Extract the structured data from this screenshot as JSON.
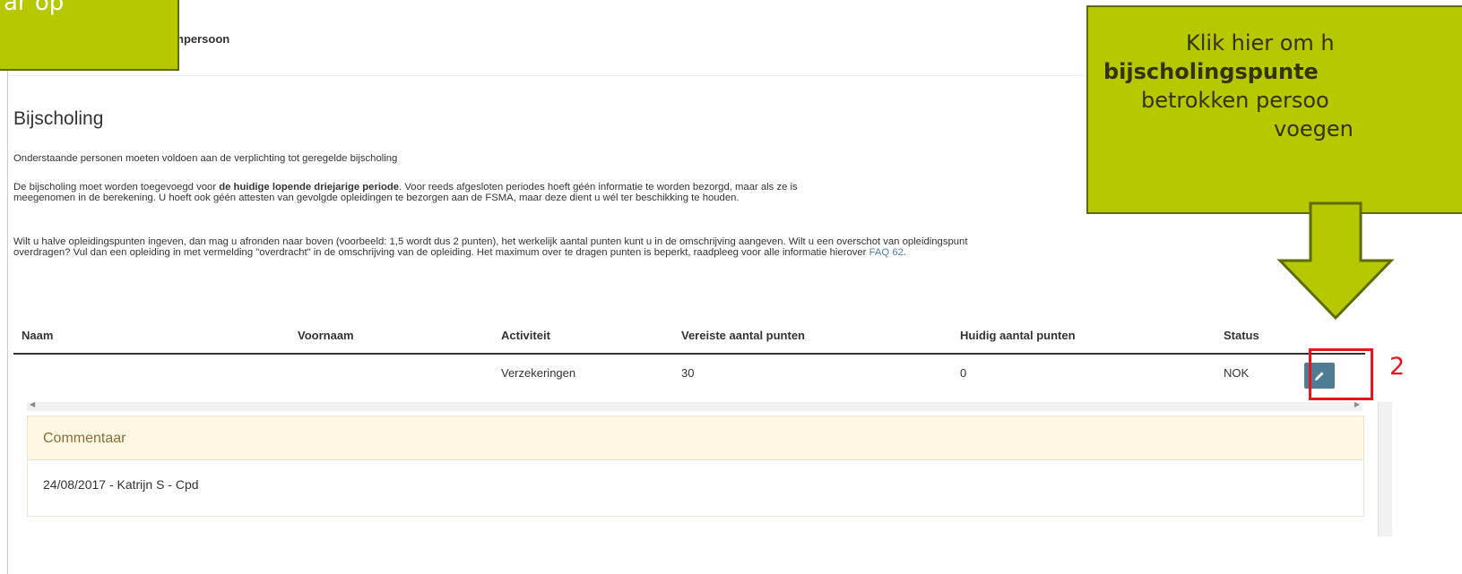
{
  "callout_top_left": {
    "text": "ar op"
  },
  "topbar": {
    "title": "npersoon"
  },
  "page": {
    "title": "Bijscholing",
    "intro": "Onderstaande personen moeten voldoen aan de verplichting tot geregelde bijscholing",
    "para2_a": "De bijscholing moet worden toegevoegd voor ",
    "para2_b": "de huidige lopende driejarige periode",
    "para2_c": ". Voor reeds afgesloten periodes hoeft géén informatie te worden bezorgd, maar als ze is",
    "para2_line2": "meegenomen in de berekening. U hoeft ook géén attesten van gevolgde opleidingen te bezorgen aan de FSMA, maar deze dient u wél ter beschikking te houden.",
    "para3_line1": "Wilt u halve opleidingspunten ingeven, dan mag u afronden naar boven (voorbeeld: 1,5 wordt dus 2 punten), het werkelijk aantal punten kunt u in de omschrijving aangeven. Wilt u een overschot van opleidingspunt",
    "para3_line2": "overdragen? Vul dan een opleiding in met vermelding \"overdracht\" in de omschrijving van de opleiding. Het maximum over te dragen punten is beperkt, raadpleeg voor alle informatie hierover ",
    "faq_link": "FAQ 62."
  },
  "table": {
    "headers": [
      "Naam",
      "Voornaam",
      "Activiteit",
      "Vereiste aantal punten",
      "Huidig aantal punten",
      "Status"
    ],
    "rows": [
      {
        "naam": "",
        "voornaam": "",
        "activiteit": "Verzekeringen",
        "vereiste": "30",
        "huidig": "0",
        "status": "NOK"
      }
    ]
  },
  "comment": {
    "header": "Commentaar",
    "entry": "24/08/2017 - Katrijn S - Cpd"
  },
  "annotation": {
    "step_number": "2",
    "callout_lines": [
      "Klik hier om h",
      "bijscholingspunte",
      "betrokken persoo",
      "voegen"
    ]
  },
  "colors": {
    "callout_fill": "#b5c800",
    "highlight": "#e8131b",
    "edit_button": "#4e7c94",
    "comment_header_bg": "#fcf8e3"
  },
  "icons": {
    "edit": "pencil-icon"
  }
}
